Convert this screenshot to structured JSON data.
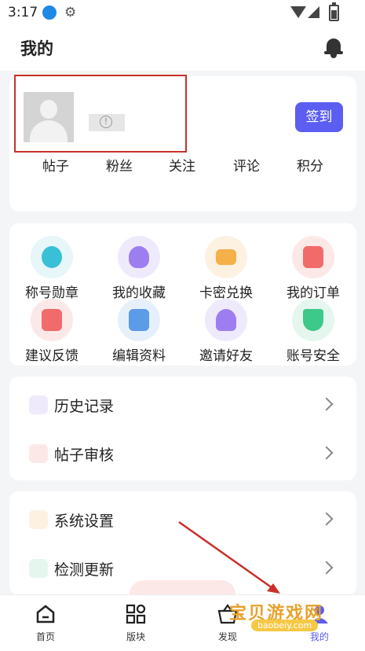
{
  "status_bar": {
    "time": "3:17"
  },
  "header": {
    "title": "我的"
  },
  "profile": {
    "checkin_label": "签到"
  },
  "stats": [
    "帖子",
    "粉丝",
    "关注",
    "评论",
    "积分"
  ],
  "features": [
    {
      "label": "称号勋章",
      "icon": "medal-icon",
      "bg": "#e6f6f9",
      "color": "#39c0d6"
    },
    {
      "label": "我的收藏",
      "icon": "heart-balloon-icon",
      "bg": "#efeafb",
      "color": "#9d7ef0"
    },
    {
      "label": "卡密兑换",
      "icon": "card-icon",
      "bg": "#fdf1e2",
      "color": "#f5b04a"
    },
    {
      "label": "我的订单",
      "icon": "order-icon",
      "bg": "#fde8e8",
      "color": "#f16b6b"
    },
    {
      "label": "建议反馈",
      "icon": "feedback-icon",
      "bg": "#fde8e8",
      "color": "#f16b6b"
    },
    {
      "label": "编辑资料",
      "icon": "edit-icon",
      "bg": "#e6f0fb",
      "color": "#5b9be8"
    },
    {
      "label": "邀请好友",
      "icon": "invite-icon",
      "bg": "#efeafb",
      "color": "#9d7ef0"
    },
    {
      "label": "账号安全",
      "icon": "shield-icon",
      "bg": "#e5f6ee",
      "color": "#3cc98a"
    }
  ],
  "list1": [
    {
      "label": "历史记录",
      "icon": "history-icon",
      "color": "#9d7ef0"
    },
    {
      "label": "帖子审核",
      "icon": "review-icon",
      "color": "#f16b6b"
    }
  ],
  "list2": [
    {
      "label": "系统设置",
      "icon": "settings-icon",
      "color": "#f5a05a"
    },
    {
      "label": "检测更新",
      "icon": "update-icon",
      "color": "#3cc98a"
    }
  ],
  "tabs": [
    {
      "label": "首页",
      "icon": "home-icon"
    },
    {
      "label": "版块",
      "icon": "grid-icon"
    },
    {
      "label": "发现",
      "icon": "basket-icon"
    },
    {
      "label": "我的",
      "icon": "user-icon"
    }
  ],
  "watermark": {
    "text": "宝贝游戏网",
    "url": "baobeiy.com"
  }
}
